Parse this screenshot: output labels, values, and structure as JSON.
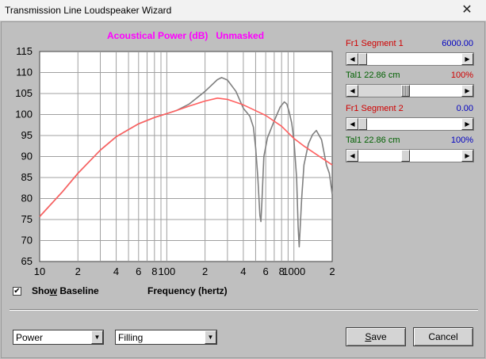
{
  "window": {
    "title": "Transmission Line Loudspeaker Wizard",
    "close_glyph": "✕"
  },
  "chart": {
    "title": "Acoustical Power (dB)   Unmasked",
    "x_axis_title": "Frequency (hertz)"
  },
  "chart_data": {
    "type": "line",
    "title": "Acoustical Power (dB)   Unmasked",
    "xlabel": "Frequency (hertz)",
    "ylabel": "",
    "xscale": "log",
    "xlim": [
      10,
      2000
    ],
    "ylim": [
      65,
      115
    ],
    "grid": true,
    "y_ticks": [
      115,
      110,
      105,
      100,
      95,
      90,
      85,
      80,
      75,
      70,
      65
    ],
    "x_tick_labels": [
      {
        "x": 10,
        "label": "10"
      },
      {
        "x": 20,
        "label": "2"
      },
      {
        "x": 40,
        "label": "4"
      },
      {
        "x": 60,
        "label": "6"
      },
      {
        "x": 80,
        "label": "8"
      },
      {
        "x": 100,
        "label": "100"
      },
      {
        "x": 200,
        "label": "2"
      },
      {
        "x": 400,
        "label": "4"
      },
      {
        "x": 600,
        "label": "6"
      },
      {
        "x": 800,
        "label": "8"
      },
      {
        "x": 1000,
        "label": "1000"
      },
      {
        "x": 2000,
        "label": "2"
      }
    ],
    "series": [
      {
        "color": "#808080",
        "x": [
          10,
          15,
          20,
          30,
          40,
          60,
          80,
          100,
          120,
          150,
          200,
          250,
          270,
          300,
          350,
          400,
          450,
          480,
          500,
          520,
          540,
          550,
          560,
          580,
          620,
          700,
          780,
          840,
          880,
          920,
          960,
          1000,
          1050,
          1080,
          1100,
          1150,
          1200,
          1300,
          1400,
          1500,
          1650,
          1800,
          1900,
          2000
        ],
        "y": [
          75.7,
          81.5,
          86,
          91.5,
          94.7,
          97.8,
          99.3,
          100.2,
          101,
          102.5,
          105.5,
          108.3,
          108.8,
          108.2,
          105.5,
          101.5,
          99.6,
          97,
          92,
          85,
          76,
          74.5,
          79,
          90,
          94.5,
          98.5,
          101.8,
          103,
          102.5,
          100.5,
          98,
          94,
          85,
          73,
          68.5,
          80,
          88,
          93,
          95.2,
          96.2,
          94,
          88,
          86,
          81
        ]
      },
      {
        "color": "#ff6060",
        "x": [
          10,
          15,
          20,
          30,
          40,
          60,
          80,
          100,
          120,
          150,
          200,
          250,
          300,
          400,
          500,
          600,
          800,
          1000,
          1200,
          1500,
          2000
        ],
        "y": [
          75.7,
          81.5,
          86,
          91.5,
          94.7,
          97.8,
          99.3,
          100.2,
          101,
          102,
          103.2,
          103.9,
          103.6,
          102.3,
          100.9,
          99.8,
          97.2,
          94.3,
          92.5,
          90.5,
          88
        ]
      }
    ]
  },
  "controls": {
    "seg1_label": "Fr1  Segment 1",
    "seg1_value": "6000.00",
    "seg1_slider": 0.0,
    "tal1a_label": "Tal1  22.86 cm",
    "tal1a_value": "100%",
    "tal1a_slider": 0.45,
    "seg2_label": "Fr1  Segment 2",
    "seg2_value": "0.00",
    "seg2_slider": 0.0,
    "tal1b_label": "Tal1  22.86 cm",
    "tal1b_value": "100%",
    "tal1b_slider": 0.45
  },
  "show_baseline": {
    "label_pre": "Sho",
    "label_ul": "w",
    "label_post": " Baseline",
    "checked": true,
    "check_glyph": "✔"
  },
  "footer": {
    "combo1_value": "Power",
    "combo2_value": "Filling",
    "save_ul": "S",
    "save_rest": "ave",
    "cancel_label": "Cancel"
  },
  "glyphs": {
    "left_arrow": "◀",
    "right_arrow": "▶",
    "down_arrow": "▼"
  }
}
